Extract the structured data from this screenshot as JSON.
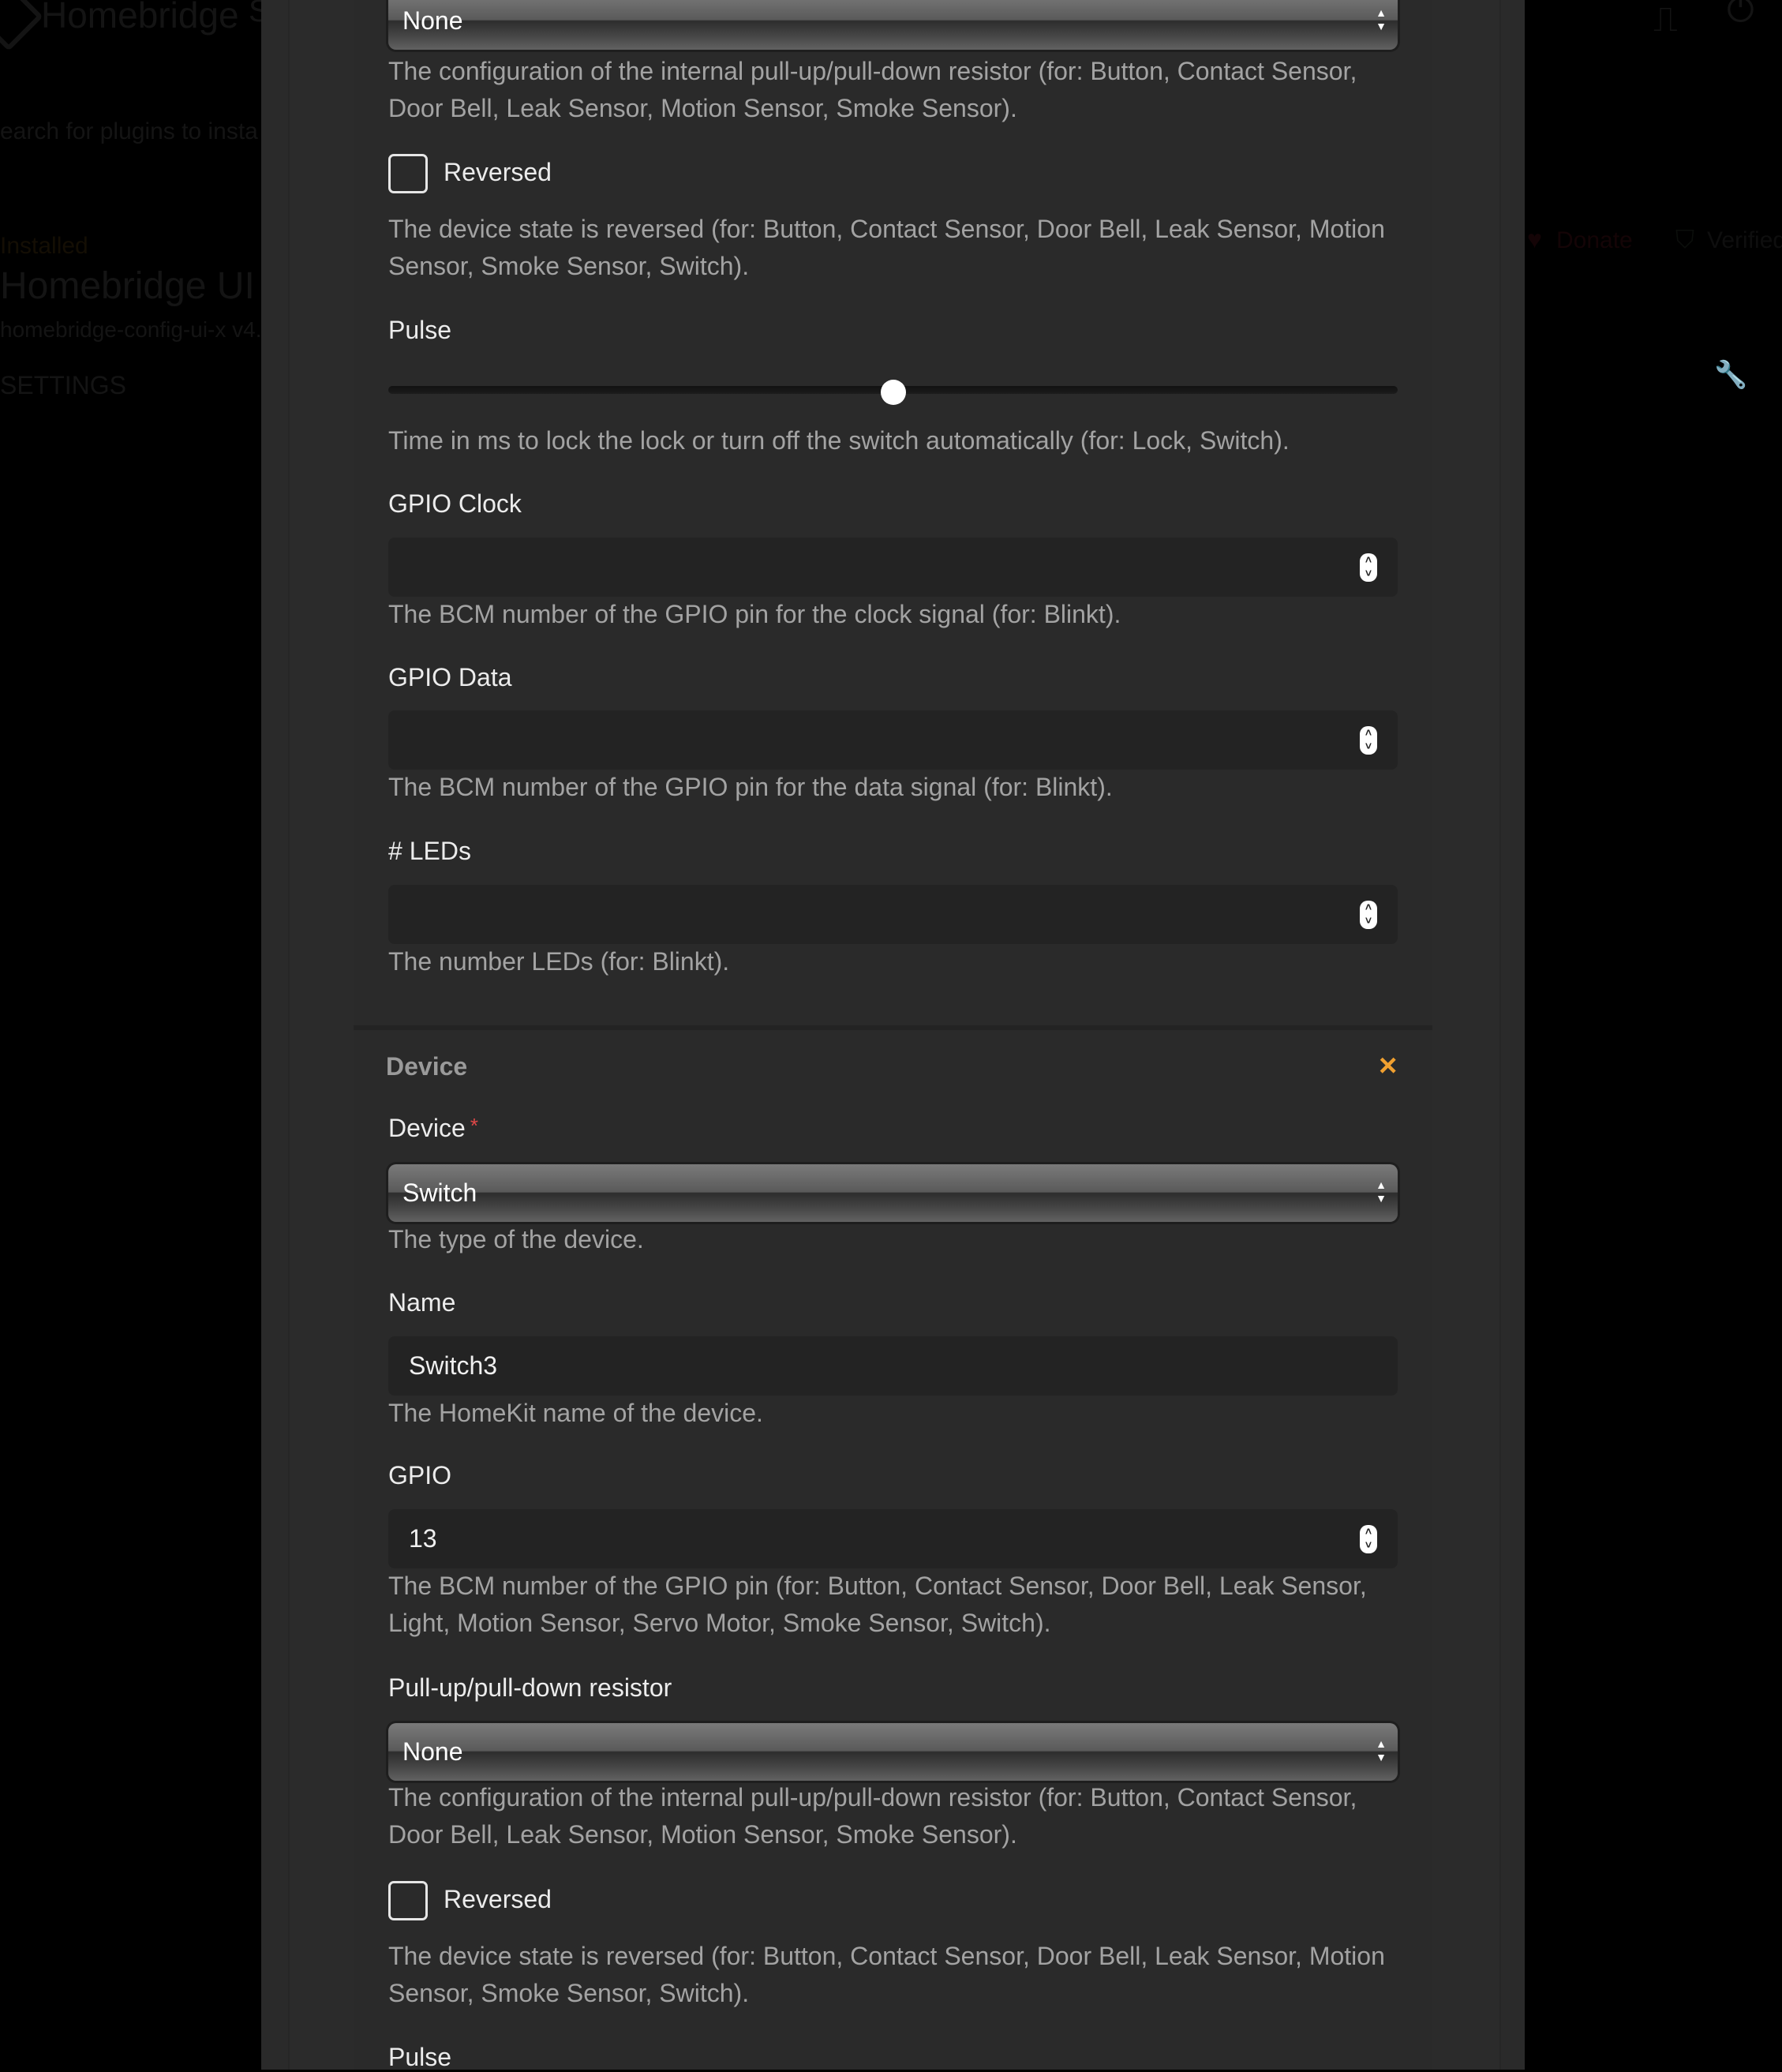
{
  "background": {
    "brand": "Homebridge",
    "nav_fragment": "S",
    "search_placeholder": "earch for plugins to insta",
    "installed_label": "Installed",
    "plugin_title": "Homebridge UI",
    "plugin_subtitle": "homebridge-config-ui-x v4.",
    "settings_label": "SETTINGS",
    "donate_label": "Donate",
    "verified_label": "Verified"
  },
  "device_1": {
    "pull_select_value": "None",
    "pull_help": "The configuration of the internal pull-up/pull-down resistor (for: Button, Contact Sensor, Door Bell, Leak Sensor, Motion Sensor, Smoke Sensor).",
    "reversed_label": "Reversed",
    "reversed_checked": false,
    "reversed_help": "The device state is reversed (for: Button, Contact Sensor, Door Bell, Leak Sensor, Motion Sensor, Smoke Sensor, Switch).",
    "pulse_label": "Pulse",
    "pulse_slider_fraction": 0.5,
    "pulse_help": "Time in ms to lock the lock or turn off the switch automatically (for: Lock, Switch).",
    "gpio_clock_label": "GPIO Clock",
    "gpio_clock_value": "",
    "gpio_clock_help": "The BCM number of the GPIO pin for the clock signal (for: Blinkt).",
    "gpio_data_label": "GPIO Data",
    "gpio_data_value": "",
    "gpio_data_help": "The BCM number of the GPIO pin for the data signal (for: Blinkt).",
    "leds_label": "# LEDs",
    "leds_value": "",
    "leds_help": "The number LEDs (for: Blinkt)."
  },
  "device_2": {
    "section_title": "Device",
    "close_icon": "×",
    "device_label": "Device",
    "required_mark": "*",
    "device_value": "Switch",
    "device_help": "The type of the device.",
    "name_label": "Name",
    "name_value": "Switch3",
    "name_help": "The HomeKit name of the device.",
    "gpio_label": "GPIO",
    "gpio_value": "13",
    "gpio_help": "The BCM number of the GPIO pin (for: Button, Contact Sensor, Door Bell, Leak Sensor, Light, Motion Sensor, Servo Motor, Smoke Sensor, Switch).",
    "pull_label": "Pull-up/pull-down resistor",
    "pull_value": "None",
    "pull_help": "The configuration of the internal pull-up/pull-down resistor (for: Button, Contact Sensor, Door Bell, Leak Sensor, Motion Sensor, Smoke Sensor).",
    "reversed_label": "Reversed",
    "reversed_checked": false,
    "reversed_help": "The device state is reversed (for: Button, Contact Sensor, Door Bell, Leak Sensor, Motion Sensor, Smoke Sensor, Switch).",
    "pulse_label": "Pulse"
  },
  "colors": {
    "accent_close": "#f0a030",
    "required": "#e04848"
  }
}
